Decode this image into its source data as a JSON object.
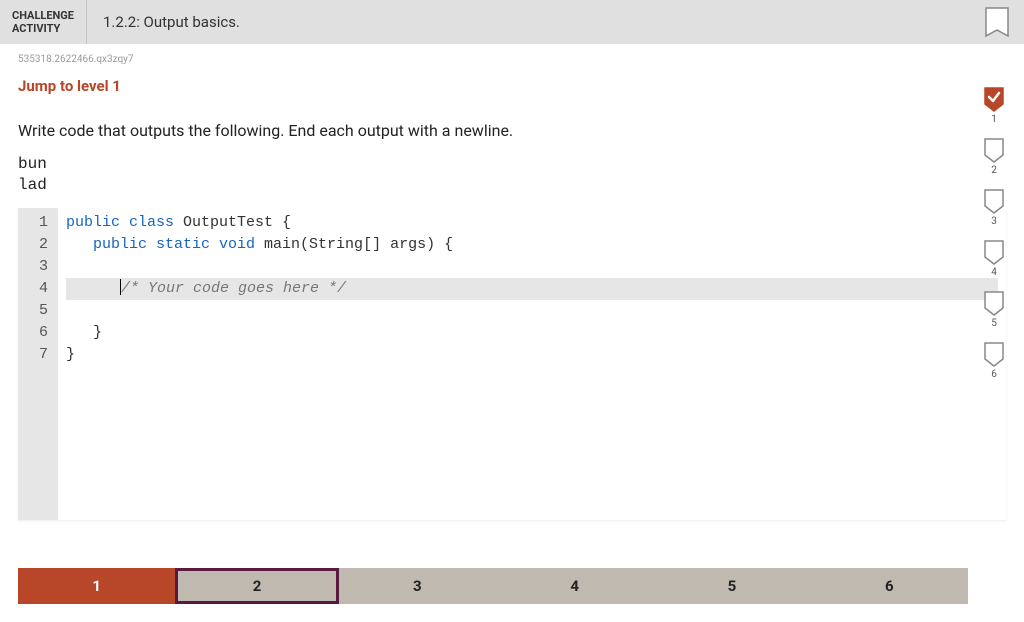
{
  "header": {
    "label": "CHALLENGE\nACTIVITY",
    "title": "1.2.2: Output basics."
  },
  "tiny_id": "535318.2622466.qx3zqy7",
  "jump_label": "Jump to level 1",
  "instructions": "Write code that outputs the following. End each output with a newline.",
  "expected_output": "bun\nlad",
  "code": {
    "lines": [
      {
        "num": "1",
        "segments": [
          {
            "t": "public class ",
            "c": "kw"
          },
          {
            "t": "OutputTest {",
            "c": "cls"
          }
        ]
      },
      {
        "num": "2",
        "segments": [
          {
            "t": "   ",
            "c": ""
          },
          {
            "t": "public static void ",
            "c": "kw"
          },
          {
            "t": "main(String[] args) {",
            "c": "cls"
          }
        ]
      },
      {
        "num": "3",
        "segments": []
      },
      {
        "num": "4",
        "highlighted": true,
        "segments": [
          {
            "t": "      ",
            "c": ""
          },
          {
            "t": "/* Your code goes here */",
            "c": "cmt"
          }
        ]
      },
      {
        "num": "5",
        "segments": []
      },
      {
        "num": "6",
        "segments": [
          {
            "t": "   }",
            "c": "cls"
          }
        ]
      },
      {
        "num": "7",
        "segments": [
          {
            "t": "}",
            "c": "cls"
          }
        ]
      }
    ]
  },
  "progress": {
    "items": [
      {
        "label": "1",
        "state": "done"
      },
      {
        "label": "2",
        "state": "current"
      },
      {
        "label": "3",
        "state": ""
      },
      {
        "label": "4",
        "state": ""
      },
      {
        "label": "5",
        "state": ""
      },
      {
        "label": "6",
        "state": ""
      }
    ]
  },
  "levels": [
    {
      "num": "1",
      "complete": true
    },
    {
      "num": "2",
      "complete": false
    },
    {
      "num": "3",
      "complete": false
    },
    {
      "num": "4",
      "complete": false
    },
    {
      "num": "5",
      "complete": false
    },
    {
      "num": "6",
      "complete": false
    }
  ]
}
